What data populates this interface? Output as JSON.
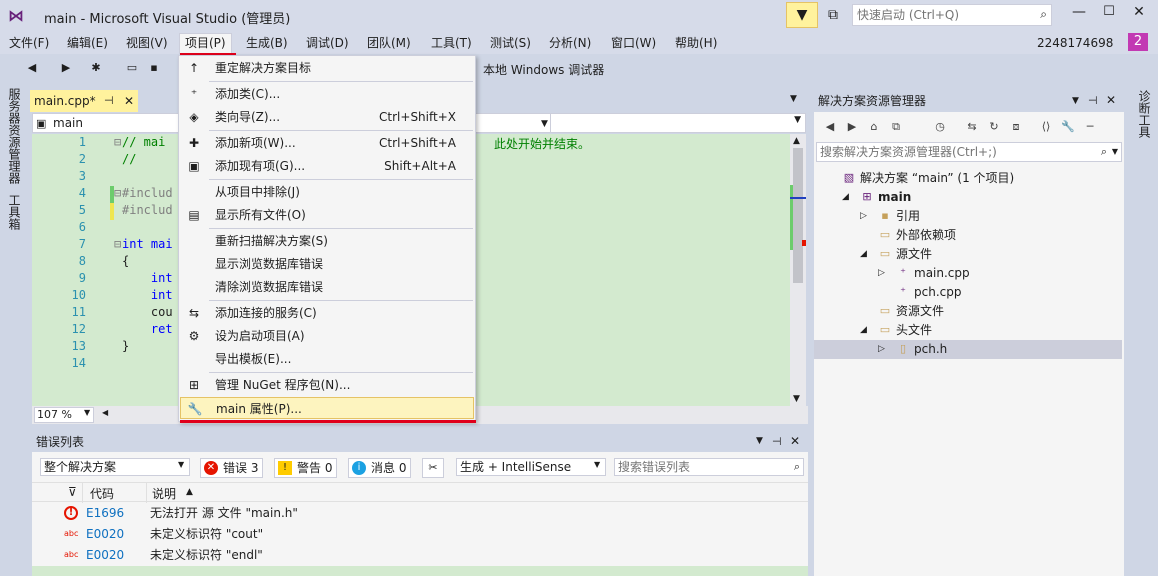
{
  "window": {
    "title": "main - Microsoft Visual Studio (管理员)",
    "quick_launch_placeholder": "快速启动 (Ctrl+Q)",
    "user": "2248174698",
    "notification_count": "2"
  },
  "menubar": {
    "items": [
      "文件(F)",
      "编辑(E)",
      "视图(V)",
      "项目(P)",
      "生成(B)",
      "调试(D)",
      "团队(M)",
      "工具(T)",
      "测试(S)",
      "分析(N)",
      "窗口(W)",
      "帮助(H)"
    ],
    "active_index": 3
  },
  "toolbar": {
    "debugger_label": "本地 Windows 调试器"
  },
  "left_tabs": [
    "服务器资源管理器",
    "工具箱"
  ],
  "right_tabs": [
    "诊断工具"
  ],
  "editor": {
    "tab_label": "main.cpp*",
    "scope": "main",
    "zoom": "107 %",
    "line_numbers": [
      "1",
      "2",
      "3",
      "4",
      "5",
      "6",
      "7",
      "8",
      "9",
      "10",
      "11",
      "12",
      "13",
      "14"
    ],
    "lines": [
      {
        "pre": "⊟",
        "text": "// mai",
        "tail": "此处开始并结束。",
        "cls": "cm"
      },
      {
        "pre": "",
        "text": "//",
        "cls": "cm"
      },
      {
        "pre": "",
        "text": "",
        "cls": ""
      },
      {
        "pre": "⊟",
        "text": "#includ",
        "cls": "pp"
      },
      {
        "pre": "",
        "text": "#includ",
        "cls": "pp"
      },
      {
        "pre": "",
        "text": "",
        "cls": ""
      },
      {
        "pre": "⊟",
        "text": "int mai",
        "cls": "kw"
      },
      {
        "pre": "",
        "text": "{",
        "cls": ""
      },
      {
        "pre": "",
        "text": "    int",
        "cls": "kw"
      },
      {
        "pre": "",
        "text": "    int",
        "cls": "kw"
      },
      {
        "pre": "",
        "text": "    cou",
        "cls": ""
      },
      {
        "pre": "",
        "text": "    ret",
        "cls": "kw"
      },
      {
        "pre": "",
        "text": "}",
        "cls": ""
      },
      {
        "pre": "",
        "text": "",
        "cls": ""
      }
    ]
  },
  "project_menu": {
    "items": [
      {
        "icon": "arrow-up-icon",
        "glyph": "↑",
        "label": "重定解决方案目标",
        "shortcut": ""
      },
      {
        "icon": "add-class-icon",
        "glyph": "⁺",
        "label": "添加类(C)...",
        "shortcut": ""
      },
      {
        "icon": "class-wizard-icon",
        "glyph": "◈",
        "label": "类向导(Z)...",
        "shortcut": "Ctrl+Shift+X"
      },
      {
        "icon": "add-new-item-icon",
        "glyph": "✚",
        "label": "添加新项(W)...",
        "shortcut": "Ctrl+Shift+A"
      },
      {
        "icon": "add-existing-item-icon",
        "glyph": "▣",
        "label": "添加现有项(G)...",
        "shortcut": "Shift+Alt+A"
      },
      {
        "icon": "",
        "glyph": "",
        "label": "从项目中排除(J)",
        "shortcut": ""
      },
      {
        "icon": "show-all-files-icon",
        "glyph": "▤",
        "label": "显示所有文件(O)",
        "shortcut": ""
      },
      {
        "icon": "",
        "glyph": "",
        "label": "重新扫描解决方案(S)",
        "shortcut": ""
      },
      {
        "icon": "",
        "glyph": "",
        "label": "显示浏览数据库错误",
        "shortcut": ""
      },
      {
        "icon": "",
        "glyph": "",
        "label": "清除浏览数据库错误",
        "shortcut": ""
      },
      {
        "icon": "add-connected-service-icon",
        "glyph": "⇆",
        "label": "添加连接的服务(C)",
        "shortcut": ""
      },
      {
        "icon": "gear-icon",
        "glyph": "⚙",
        "label": "设为启动项目(A)",
        "shortcut": ""
      },
      {
        "icon": "",
        "glyph": "",
        "label": "导出模板(E)...",
        "shortcut": ""
      },
      {
        "icon": "nuget-icon",
        "glyph": "⊞",
        "label": "管理 NuGet 程序包(N)...",
        "shortcut": ""
      },
      {
        "icon": "wrench-icon",
        "glyph": "🔧",
        "label": "main 属性(P)...",
        "shortcut": ""
      }
    ]
  },
  "error_list": {
    "title": "错误列表",
    "scope": "整个解决方案",
    "errors_label": "错误 3",
    "warnings_label": "警告 0",
    "messages_label": "消息 0",
    "build_filter": "生成 + IntelliSense",
    "search_placeholder": "搜索错误列表",
    "col_code": "代码",
    "col_desc": "说明",
    "rows": [
      {
        "kind": "error",
        "code": "E1696",
        "desc": "无法打开 源 文件 \"main.h\""
      },
      {
        "kind": "abc",
        "code": "E0020",
        "desc": "未定义标识符 \"cout\""
      },
      {
        "kind": "abc",
        "code": "E0020",
        "desc": "未定义标识符 \"endl\""
      }
    ]
  },
  "solution_explorer": {
    "title": "解决方案资源管理器",
    "search_placeholder": "搜索解决方案资源管理器(Ctrl+;)",
    "tree": [
      {
        "label": "解决方案 “main” (1 个项目)",
        "level": 0,
        "exp": "",
        "icon": "solution-icon",
        "glyph": "▧",
        "bold": false,
        "selected": false
      },
      {
        "label": "main",
        "level": 1,
        "exp": "◢",
        "icon": "project-icon",
        "glyph": "⊞",
        "bold": true,
        "selected": false
      },
      {
        "label": "引用",
        "level": 2,
        "exp": "▷",
        "icon": "references-icon",
        "glyph": "▪",
        "bold": false,
        "selected": false
      },
      {
        "label": "外部依赖项",
        "level": 2,
        "exp": "",
        "icon": "folder-icon",
        "glyph": "▭",
        "bold": false,
        "selected": false
      },
      {
        "label": "源文件",
        "level": 2,
        "exp": "◢",
        "icon": "folder-icon",
        "glyph": "▭",
        "bold": false,
        "selected": false
      },
      {
        "label": "main.cpp",
        "level": 3,
        "exp": "▷",
        "icon": "cpp-file-icon",
        "glyph": "⁺",
        "bold": false,
        "selected": false
      },
      {
        "label": "pch.cpp",
        "level": 3,
        "exp": "",
        "icon": "cpp-file-icon",
        "glyph": "⁺",
        "bold": false,
        "selected": false
      },
      {
        "label": "资源文件",
        "level": 2,
        "exp": "",
        "icon": "folder-icon",
        "glyph": "▭",
        "bold": false,
        "selected": false
      },
      {
        "label": "头文件",
        "level": 2,
        "exp": "◢",
        "icon": "folder-icon",
        "glyph": "▭",
        "bold": false,
        "selected": false
      },
      {
        "label": "pch.h",
        "level": 3,
        "exp": "▷",
        "icon": "header-file-icon",
        "glyph": "▯",
        "bold": false,
        "selected": true
      }
    ]
  },
  "colors": {
    "accent": "#68217a",
    "highlight_red": "#e0001b",
    "menu_highlight": "#fdf4bf"
  }
}
